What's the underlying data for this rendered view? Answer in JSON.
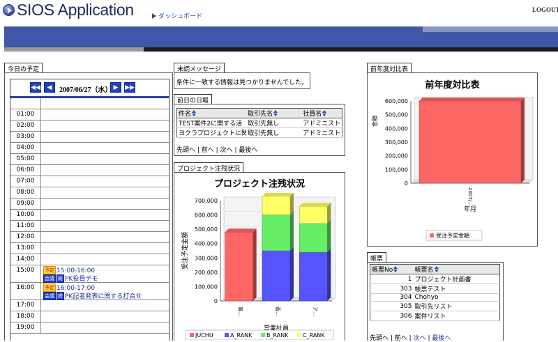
{
  "header": {
    "app_title": "SIOS Application",
    "breadcrumb": "ダッシュボード",
    "logout": "LOGOUT"
  },
  "today": {
    "tab": "今日の予定",
    "date": "2007/06/27（水）",
    "hours": [
      "01:00",
      "02:00",
      "03:00",
      "04:00",
      "05:00",
      "06:00",
      "07:00",
      "08:00",
      "09:00",
      "10:00",
      "11:00",
      "12:00",
      "13:00",
      "14:00",
      "15:00",
      "16:00",
      "17:00",
      "18:00",
      "19:00"
    ],
    "events": [
      {
        "badge": "予定",
        "tags": [
          "会議",
          "総"
        ],
        "time": "15:00-16:00",
        "title": "PK役員デモ"
      },
      {
        "badge": "予定",
        "tags": [
          "会議",
          "総"
        ],
        "time": "16:00-17:00",
        "title": "PK記者発表に関する打合せ"
      }
    ]
  },
  "unread": {
    "tab": "未読メッセージ",
    "text": "条件に一致する情報は見つかりませんでした。"
  },
  "daily": {
    "tab": "前日の日報",
    "columns": [
      "件名",
      "取引先名",
      "社員名"
    ],
    "rows": [
      [
        "TEST案件2に関する活",
        "取引先無し",
        "アドミニスト"
      ],
      [
        "ヨクラプロジェクトに関す",
        "取引先無し",
        "アドミニスト"
      ]
    ],
    "pager": [
      "先頭へ",
      "前へ",
      "次へ",
      "最後へ"
    ]
  },
  "project": {
    "tab": "プロジェクト注残状況",
    "chart_data": {
      "type": "bar",
      "stacked": true,
      "title": "プロジェクト注残状況",
      "xlabel": "営業社員",
      "ylabel": "受注予定金額",
      "ylim": [
        0,
        700000
      ],
      "yticks": [
        "0",
        "100,000",
        "200,000",
        "300,000",
        "400,000",
        "500,000",
        "600,000",
        "700,000"
      ],
      "categories": [
        "事…",
        "菅…",
        "ア…"
      ],
      "series": [
        {
          "name": "JUCHU",
          "color": "#ff6666",
          "values": [
            480000,
            0,
            0
          ]
        },
        {
          "name": "A_RANK",
          "color": "#5555ff",
          "values": [
            0,
            350000,
            340000
          ]
        },
        {
          "name": "B_RANK",
          "color": "#66ee66",
          "values": [
            0,
            250000,
            200000
          ]
        },
        {
          "name": "C_RANK",
          "color": "#ffff66",
          "values": [
            0,
            130000,
            120000
          ]
        }
      ],
      "legend": "bottom"
    }
  },
  "yoy": {
    "tab": "前年度対比表",
    "chart_data": {
      "type": "bar",
      "title": "前年度対比表",
      "xlabel": "年月",
      "ylabel": "金額",
      "ylim": [
        0,
        600000
      ],
      "yticks": [
        "0",
        "100,000",
        "200,000",
        "300,000",
        "400,000",
        "500,000",
        "600,000"
      ],
      "categories": [
        "2007/..."
      ],
      "series": [
        {
          "name": "受注予定金額",
          "color": "#ff6666",
          "values": [
            600000
          ]
        }
      ],
      "legend": "bottom"
    }
  },
  "forms": {
    "tab": "帳票",
    "columns": [
      "帳票No",
      "帳票名"
    ],
    "rows": [
      [
        "1",
        "プロジェクト計画書"
      ],
      [
        "303",
        "帳票テスト"
      ],
      [
        "304",
        "Chohyo"
      ],
      [
        "305",
        "取引先リスト"
      ],
      [
        "306",
        "案件リスト"
      ]
    ],
    "pager": [
      "先頭へ",
      "前へ",
      "次へ",
      "最後へ"
    ]
  }
}
